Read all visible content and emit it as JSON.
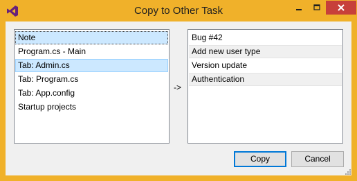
{
  "window": {
    "title": "Copy to Other Task"
  },
  "source_list": {
    "items": [
      "Note",
      "Program.cs - Main",
      "Tab: Admin.cs",
      "Tab: Program.cs",
      "Tab: App.config",
      "Startup projects"
    ]
  },
  "arrow_text": "->",
  "target_list": {
    "items": [
      "Bug #42",
      "Add new user type",
      "Version update",
      "Authentication"
    ]
  },
  "buttons": {
    "copy": "Copy",
    "cancel": "Cancel"
  },
  "colors": {
    "titlebar": "#f0b12a",
    "close": "#c7403a",
    "selection": "#cce8ff",
    "accent": "#0078d7"
  }
}
